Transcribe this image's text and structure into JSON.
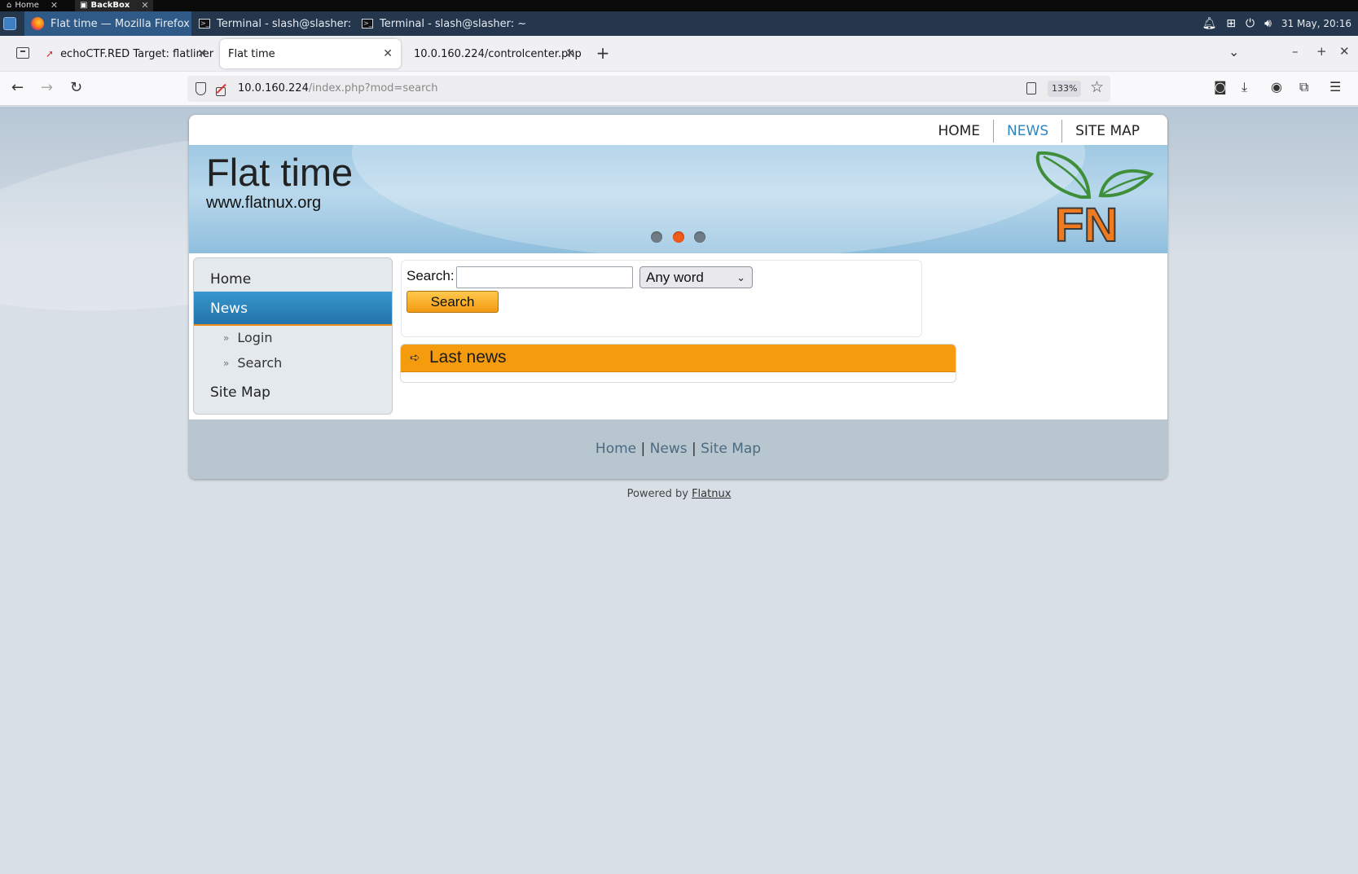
{
  "os": {
    "tabs": [
      {
        "label": "Home"
      },
      {
        "label": "BackBox"
      }
    ],
    "taskbar": [
      {
        "label": "Flat time — Mozilla Firefox"
      },
      {
        "label": "Terminal - slash@slasher: ~/..."
      },
      {
        "label": "Terminal - slash@slasher: ~"
      }
    ],
    "clock": "31 May, 20:16"
  },
  "browser": {
    "tabs": [
      {
        "label": "echoCTF.RED Target: flatliner"
      },
      {
        "label": "Flat time"
      },
      {
        "label": "10.0.160.224/controlcenter.php"
      }
    ],
    "url_host": "10.0.160.224",
    "url_path": "/index.php?mod=search",
    "zoom": "133%"
  },
  "site": {
    "topnav": [
      "HOME",
      "NEWS",
      "SITE MAP"
    ],
    "title": "Flat time",
    "subtitle": "www.flatnux.org",
    "logo_text": "FN",
    "sidebar": {
      "home": "Home",
      "news": "News",
      "login": "Login",
      "search": "Search",
      "sitemap": "Site Map"
    },
    "search": {
      "label": "Search:",
      "input_value": "",
      "mode": "Any word",
      "button": "Search"
    },
    "last_news": "Last news",
    "footer": {
      "home": "Home",
      "news": "News",
      "sitemap": "Site Map",
      "separator": "|"
    },
    "powered_by": "Powered by",
    "powered_link": "Flatnux"
  },
  "colors": {
    "accent_orange": "#f59c0e",
    "nav_blue": "#2e86c1",
    "taskbar": "#24374c"
  }
}
